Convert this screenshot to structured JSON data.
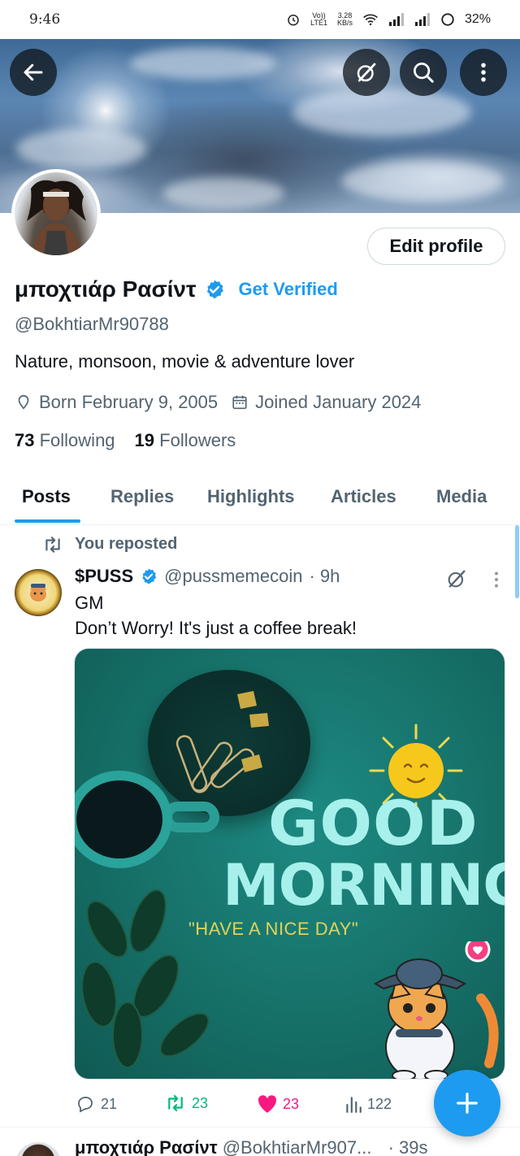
{
  "status_bar": {
    "time": "9:46",
    "net_type": "LTE1",
    "volte": "Vo))",
    "data_rate": "3.28",
    "data_unit": "KB/s",
    "battery": "32%"
  },
  "profile": {
    "display_name": "μποχτιάρ Ρασίντ",
    "get_verified": "Get Verified",
    "handle": "@BokhtiarMr90788",
    "bio": "Nature, monsoon, movie & adventure lover",
    "born": "Born February 9, 2005",
    "joined": "Joined January 2024",
    "following_count": "73",
    "following_label": "Following",
    "followers_count": "19",
    "followers_label": "Followers",
    "edit_profile": "Edit profile"
  },
  "tabs": [
    {
      "label": "Posts",
      "active": true
    },
    {
      "label": "Replies",
      "active": false
    },
    {
      "label": "Highlights",
      "active": false
    },
    {
      "label": "Articles",
      "active": false
    },
    {
      "label": "Media",
      "active": false
    }
  ],
  "post": {
    "repost_label": "You reposted",
    "name": "$PUSS",
    "handle": "@pussmemecoin",
    "time": "· 9h",
    "line1": "GM",
    "line2": "Don’t Worry! It's just a coffee break!",
    "image_text": {
      "good": "GOOD",
      "morning": "MORNING",
      "sub": "\"HAVE A NICE DAY\""
    },
    "replies": "21",
    "reposts": "23",
    "likes": "23",
    "views": "122",
    "repost_color": "#00ba7c",
    "like_color": "#f91880"
  },
  "next_post": {
    "name": "μποχτιάρ Ρασίντ",
    "handle": "@BokhtiarMr907...",
    "time": "· 39s"
  },
  "colors": {
    "accent": "#1d9bf0",
    "text_primary": "#0f1419",
    "text_secondary": "#536471"
  },
  "icons": [
    "back-arrow-icon",
    "grok-icon",
    "search-icon",
    "more-vertical-icon",
    "verified-badge-icon",
    "location-icon",
    "calendar-icon",
    "repost-icon",
    "reply-icon",
    "like-icon",
    "views-icon",
    "plus-icon"
  ]
}
